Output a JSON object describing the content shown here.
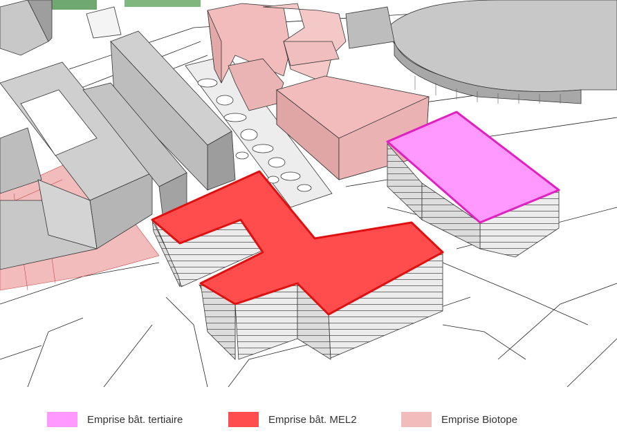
{
  "legend": {
    "items": [
      {
        "label": "Emprise bât. tertiaire",
        "color": "#ff99ff"
      },
      {
        "label": "Emprise bât. MEL2",
        "color": "#ff4d4d"
      },
      {
        "label": "Emprise Biotope",
        "color": "#f2bcbc"
      }
    ]
  },
  "colors": {
    "tertiaire_roof": "#ff99ff",
    "tertiaire_edge": "#e020c0",
    "mel2_roof": "#ff4d4d",
    "mel2_edge": "#e01010",
    "biotope": "#f2bcbc",
    "existing_building": "#c8c8c8",
    "facade": "#e6e6e6",
    "vegetation": "#6fa870"
  }
}
